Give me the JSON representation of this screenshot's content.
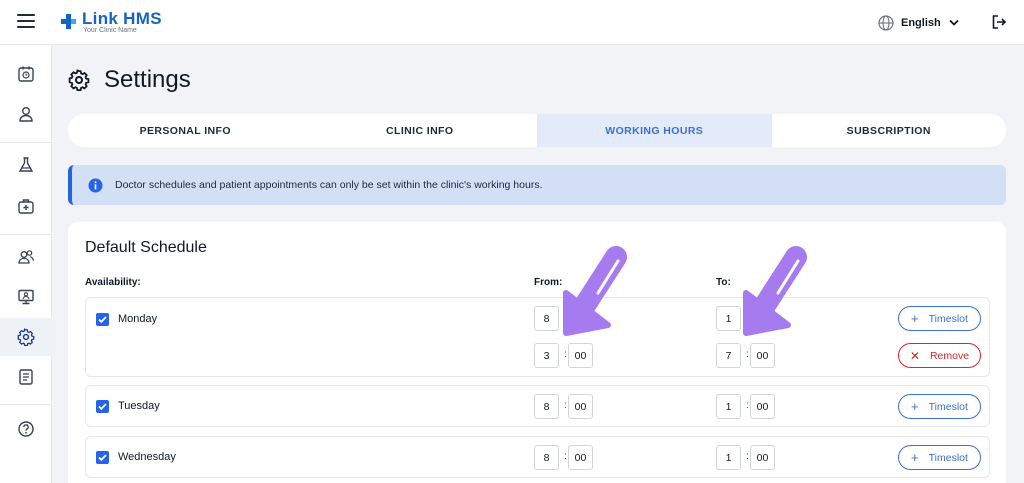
{
  "app": {
    "name": "Link HMS",
    "subtitle": "Your Clinic Name",
    "language": "English"
  },
  "colors": {
    "brand": "#1565c0",
    "accent": "#2563eb",
    "active_tab": "#3b6fd4",
    "danger": "#dc2626",
    "annotation_arrow": "#a77bf0"
  },
  "sidebar": {
    "items": [
      {
        "icon": "calendar-clock-icon",
        "active": false
      },
      {
        "icon": "user-icon",
        "active": false
      },
      {
        "icon": "flask-icon",
        "active": false
      },
      {
        "icon": "medical-kit-icon",
        "active": false
      },
      {
        "icon": "users-icon",
        "active": false
      },
      {
        "icon": "monitor-user-icon",
        "active": false
      },
      {
        "icon": "gear-icon",
        "active": true
      },
      {
        "icon": "report-icon",
        "active": false
      },
      {
        "icon": "help-icon",
        "active": false
      }
    ]
  },
  "page": {
    "title": "Settings",
    "tabs": [
      {
        "label": "PERSONAL INFO",
        "active": false
      },
      {
        "label": "CLINIC INFO",
        "active": false
      },
      {
        "label": "WORKING HOURS",
        "active": true
      },
      {
        "label": "SUBSCRIPTION",
        "active": false
      }
    ],
    "alert": "Doctor schedules and patient appointments can only be set within the clinic's working hours."
  },
  "schedule": {
    "title": "Default Schedule",
    "availability_label": "Availability:",
    "from_label": "From:",
    "to_label": "To:",
    "add_label": "Timeslot",
    "remove_label": "Remove",
    "days": [
      {
        "name": "Monday",
        "checked": true,
        "slots": [
          {
            "from_h": "8",
            "from_m": "",
            "to_h": "1",
            "to_m": ""
          },
          {
            "from_h": "3",
            "from_m": "00",
            "to_h": "7",
            "to_m": "00"
          }
        ]
      },
      {
        "name": "Tuesday",
        "checked": true,
        "slots": [
          {
            "from_h": "8",
            "from_m": "00",
            "to_h": "1",
            "to_m": "00"
          }
        ]
      },
      {
        "name": "Wednesday",
        "checked": true,
        "slots": [
          {
            "from_h": "8",
            "from_m": "00",
            "to_h": "1",
            "to_m": "00"
          }
        ]
      }
    ]
  }
}
